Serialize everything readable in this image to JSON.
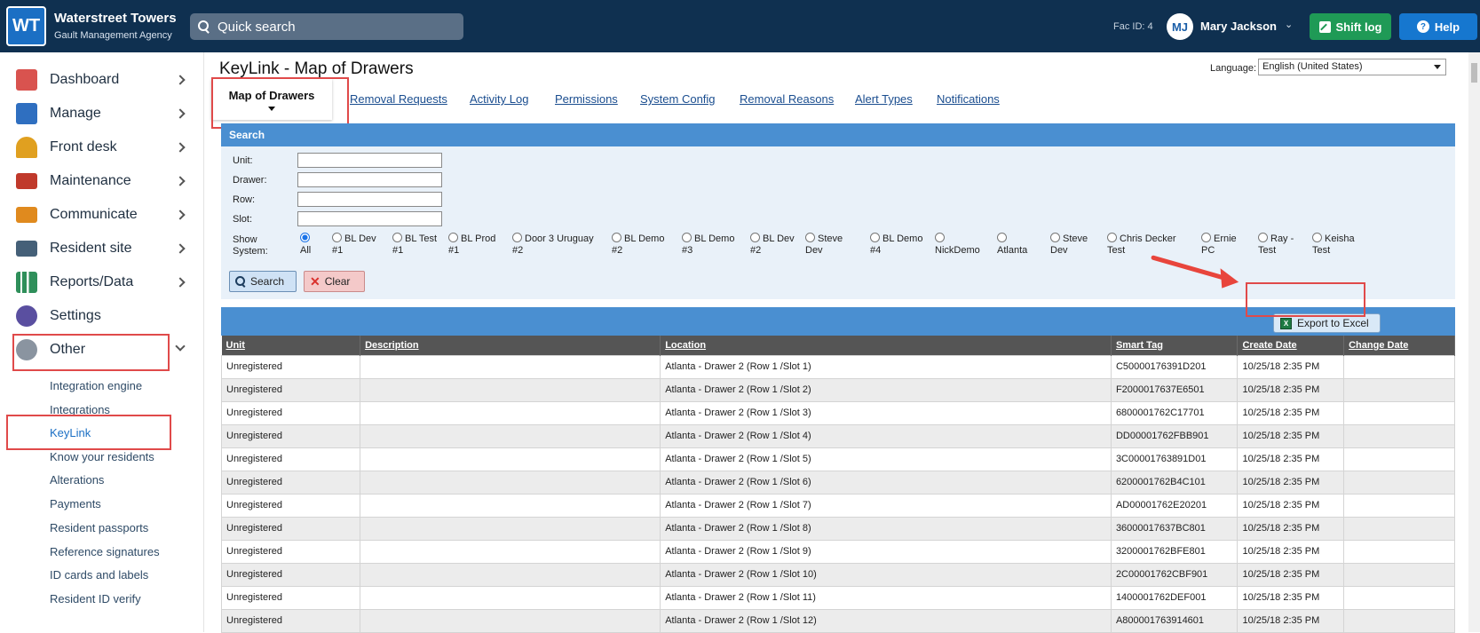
{
  "topbar": {
    "logo": "WT",
    "brand_name": "Waterstreet Towers",
    "brand_sub": "Gault Management Agency",
    "search_placeholder": "Quick search",
    "fac_id": "Fac ID: 4",
    "avatar_initials": "MJ",
    "user_name": "Mary Jackson",
    "shift_log": "Shift log",
    "help": "Help"
  },
  "sidebar": {
    "items": [
      {
        "label": "Dashboard",
        "icon": "house-icon",
        "color": "#d9534f"
      },
      {
        "label": "Manage",
        "icon": "building-icon",
        "color": "#2f6fc0"
      },
      {
        "label": "Front desk",
        "icon": "bell-icon",
        "color": "#e0a020"
      },
      {
        "label": "Maintenance",
        "icon": "toolbox-icon",
        "color": "#c0392b"
      },
      {
        "label": "Communicate",
        "icon": "envelope-icon",
        "color": "#e08a1e"
      },
      {
        "label": "Resident site",
        "icon": "monitor-icon",
        "color": "#456078"
      },
      {
        "label": "Reports/Data",
        "icon": "chart-icon",
        "color": "#2f8f5a"
      },
      {
        "label": "Settings",
        "icon": "gear-icon",
        "color": "#5a4fa0"
      },
      {
        "label": "Other",
        "icon": "more-icon",
        "color": "#8a94a0"
      }
    ],
    "sub_items": [
      "Integration engine",
      "Integrations",
      "KeyLink",
      "Know your residents",
      "Alterations",
      "Payments",
      "Resident passports",
      "Reference signatures",
      "ID cards and labels",
      "Resident ID verify"
    ]
  },
  "page": {
    "title": "KeyLink - Map of Drawers",
    "language_label": "Language:",
    "language_value": "English (United States)",
    "tabs": [
      "Map of Drawers",
      "Removal Requests",
      "Activity Log",
      "Permissions",
      "System Config",
      "Removal Reasons",
      "Alert Types",
      "Notifications"
    ]
  },
  "search": {
    "header": "Search",
    "fields": [
      "Unit:",
      "Drawer:",
      "Row:",
      "Slot:"
    ],
    "show_system_label_1": "Show",
    "show_system_label_2": "System:",
    "systems": [
      [
        "",
        "All"
      ],
      [
        "BL Dev",
        "#1"
      ],
      [
        "BL Test",
        "#1"
      ],
      [
        "BL Prod",
        "#1"
      ],
      [
        "Door 3 Uruguay",
        "#2"
      ],
      [
        "BL Demo",
        "#2"
      ],
      [
        "BL Demo",
        "#3"
      ],
      [
        "BL Dev",
        "#2"
      ],
      [
        "Steve",
        "Dev"
      ],
      [
        "BL Demo",
        "#4"
      ],
      [
        "",
        "NickDemo"
      ],
      [
        "",
        "Atlanta"
      ],
      [
        "Steve",
        "Dev"
      ],
      [
        "Chris Decker",
        "Test"
      ],
      [
        "Ernie",
        "PC"
      ],
      [
        "Ray -",
        "Test"
      ],
      [
        "Keisha",
        "Test"
      ]
    ],
    "search_button": "Search",
    "clear_button": "Clear"
  },
  "results": {
    "export_button": "Export to Excel",
    "columns": [
      "Unit",
      "Description",
      "Location",
      "Smart Tag",
      "Create Date",
      "Change Date"
    ],
    "rows": [
      [
        "Unregistered",
        "",
        "Atlanta - Drawer 2 (Row 1 /Slot 1)",
        "C50000176391D201",
        "10/25/18 2:35 PM",
        ""
      ],
      [
        "Unregistered",
        "",
        "Atlanta - Drawer 2 (Row 1 /Slot 2)",
        "F2000017637E6501",
        "10/25/18 2:35 PM",
        ""
      ],
      [
        "Unregistered",
        "",
        "Atlanta - Drawer 2 (Row 1 /Slot 3)",
        "6800001762C17701",
        "10/25/18 2:35 PM",
        ""
      ],
      [
        "Unregistered",
        "",
        "Atlanta - Drawer 2 (Row 1 /Slot 4)",
        "DD00001762FBB901",
        "10/25/18 2:35 PM",
        ""
      ],
      [
        "Unregistered",
        "",
        "Atlanta - Drawer 2 (Row 1 /Slot 5)",
        "3C00001763891D01",
        "10/25/18 2:35 PM",
        ""
      ],
      [
        "Unregistered",
        "",
        "Atlanta - Drawer 2 (Row 1 /Slot 6)",
        "6200001762B4C101",
        "10/25/18 2:35 PM",
        ""
      ],
      [
        "Unregistered",
        "",
        "Atlanta - Drawer 2 (Row 1 /Slot 7)",
        "AD00001762E20201",
        "10/25/18 2:35 PM",
        ""
      ],
      [
        "Unregistered",
        "",
        "Atlanta - Drawer 2 (Row 1 /Slot 8)",
        "36000017637BC801",
        "10/25/18 2:35 PM",
        ""
      ],
      [
        "Unregistered",
        "",
        "Atlanta - Drawer 2 (Row 1 /Slot 9)",
        "3200001762BFE801",
        "10/25/18 2:35 PM",
        ""
      ],
      [
        "Unregistered",
        "",
        "Atlanta - Drawer 2 (Row 1 /Slot 10)",
        "2C00001762CBF901",
        "10/25/18 2:35 PM",
        ""
      ],
      [
        "Unregistered",
        "",
        "Atlanta - Drawer 2 (Row 1 /Slot 11)",
        "1400001762DEF001",
        "10/25/18 2:35 PM",
        ""
      ],
      [
        "Unregistered",
        "",
        "Atlanta - Drawer 2 (Row 1 /Slot 12)",
        "A800001763914601",
        "10/25/18 2:35 PM",
        ""
      ]
    ]
  }
}
